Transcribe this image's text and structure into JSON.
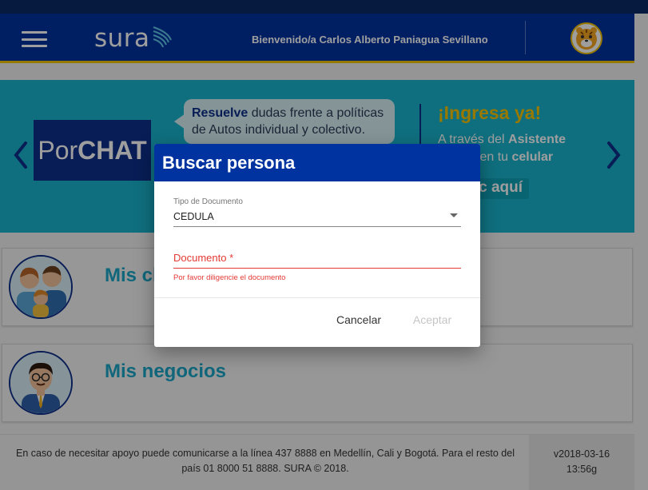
{
  "header": {
    "logo_text": "sura",
    "welcome_text": "Bienvenido/a Carlos Alberto Paniagua Sevillano"
  },
  "banner": {
    "porchat_prefix": "Por",
    "porchat_bold": "CHAT",
    "bubble_bold": "Resuelve",
    "bubble_rest": " dudas frente a políticas de Autos individual y colectivo.",
    "ingresa": "¡Ingresa ya!",
    "asistente_pre": "A través del ",
    "asistente_bold1": "Asistente virtual",
    "asistente_mid": " en tu ",
    "asistente_bold2": "celular",
    "click_label": "c aquí"
  },
  "cards": [
    {
      "title": "Mis cl"
    },
    {
      "title": "Mis negocios"
    }
  ],
  "footer": {
    "text": "En caso de necesitar apoyo puede comunicarse a la línea 437 8888 en Medellín, Cali y Bogotá. Para el resto del país 01 8000 51 8888. SURA © 2018.",
    "version": "v2018-03-16 13:56g"
  },
  "dialog": {
    "title": "Buscar persona",
    "doc_type_label": "Tipo de Documento",
    "doc_type_value": "CEDULA",
    "doc_placeholder": "Documento *",
    "error": "Por favor diligencie el documento",
    "cancel_label": "Cancelar",
    "accept_label": "Aceptar"
  },
  "colors": {
    "brand_blue": "#0033a0",
    "accent_yellow": "#f4c300",
    "banner_cyan": "#19b3cc",
    "error_red": "#e53935"
  }
}
